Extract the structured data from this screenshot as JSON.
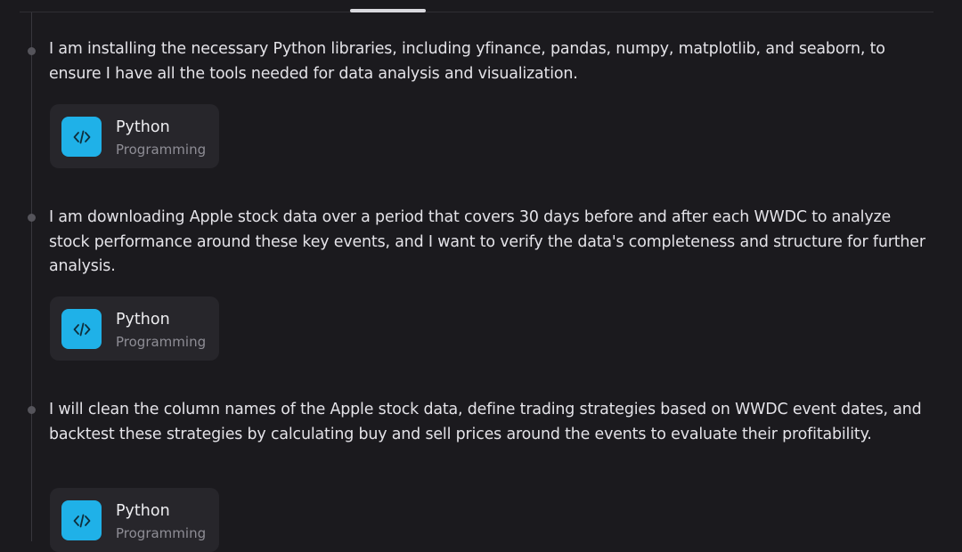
{
  "steps": [
    {
      "text": "I am installing the necessary Python libraries, including yfinance, pandas, numpy, matplotlib, and seaborn, to ensure I have all the tools needed for data analysis and visualization.",
      "tool": {
        "name": "Python",
        "type": "Programming",
        "icon": "code-brackets-icon"
      }
    },
    {
      "text": "I am downloading Apple stock data over a period that covers 30 days before and after each WWDC to analyze stock performance around these key events, and I want to verify the data's completeness and structure for further analysis.",
      "tool": {
        "name": "Python",
        "type": "Programming",
        "icon": "code-brackets-icon"
      }
    },
    {
      "text": "I will clean the column names of the Apple stock data, define trading strategies based on WWDC event dates, and backtest these strategies by calculating buy and sell prices around the events to evaluate their profitability.",
      "tool": {
        "name": "Python",
        "type": "Programming",
        "icon": "code-brackets-icon"
      }
    }
  ],
  "colors": {
    "background": "#1b1a1e",
    "card": "#27262b",
    "icon_accent": "#1fb1e8",
    "text_primary": "#e4e3e8",
    "text_secondary": "#8e8d95"
  }
}
